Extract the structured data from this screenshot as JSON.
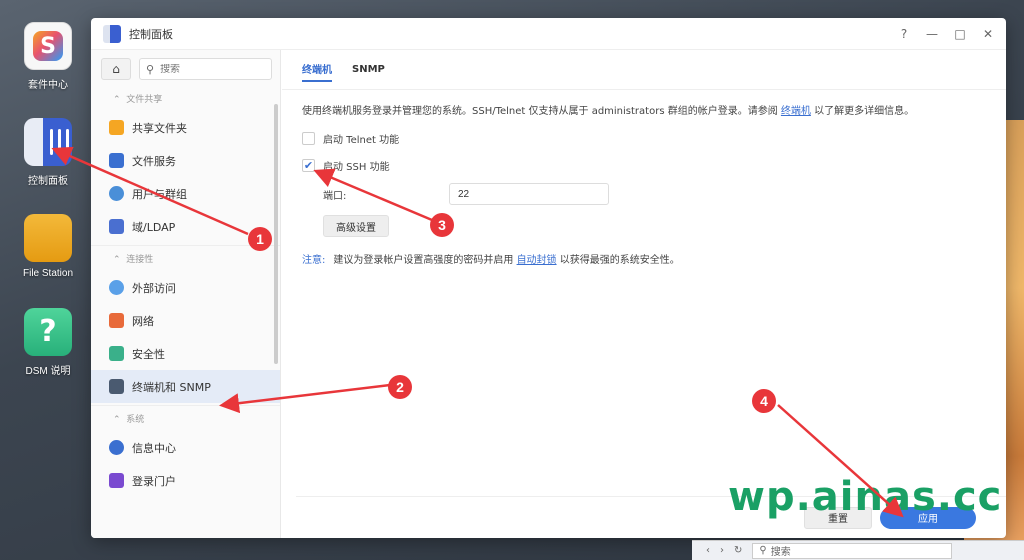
{
  "desktop": {
    "icons": [
      {
        "label": "套件中心",
        "glyph": "S"
      },
      {
        "label": "控制面板"
      },
      {
        "label": "File Station"
      },
      {
        "label": "DSM 说明",
        "glyph": "?"
      }
    ]
  },
  "window": {
    "title": "控制面板",
    "controls": {
      "help": "?",
      "minimize": "—",
      "maximize": "□",
      "close": "✕"
    }
  },
  "sidebar": {
    "home_glyph": "⌂",
    "search_placeholder": "搜索",
    "groups": [
      {
        "title": "文件共享",
        "items": [
          {
            "label": "共享文件夹",
            "color": "#f5a623"
          },
          {
            "label": "文件服务",
            "color": "#3a6fd0"
          },
          {
            "label": "用户与群组",
            "color": "#4a8fd8"
          },
          {
            "label": "域/LDAP",
            "color": "#4a6fd0"
          }
        ]
      },
      {
        "title": "连接性",
        "items": [
          {
            "label": "外部访问",
            "color": "#5aa0e8"
          },
          {
            "label": "网络",
            "color": "#e86a3a"
          },
          {
            "label": "安全性",
            "color": "#3ab08a"
          },
          {
            "label": "终端机和 SNMP",
            "color": "#4a5a70"
          }
        ]
      },
      {
        "title": "系统",
        "items": [
          {
            "label": "信息中心",
            "color": "#3a6fd0"
          },
          {
            "label": "登录门户",
            "color": "#7a4ad0"
          }
        ]
      }
    ],
    "active": "终端机和 SNMP"
  },
  "main": {
    "tabs": [
      {
        "label": "终端机"
      },
      {
        "label": "SNMP"
      }
    ],
    "active_tab": "终端机",
    "description_pre": "使用终端机服务登录并管理您的系统。SSH/Telnet 仅支持从属于 administrators 群组的帐户登录。请参阅 ",
    "description_link": "终端机",
    "description_post": " 以了解更多详细信息。",
    "telnet_label": "启动 Telnet 功能",
    "telnet_checked": false,
    "ssh_label": "启动 SSH 功能",
    "ssh_checked": true,
    "check_glyph": "✔",
    "port_label": "端口:",
    "port_value": "22",
    "advanced_button": "高级设置",
    "note_label": "注意:",
    "note_pre": "建议为登录帐户设置高强度的密码并启用 ",
    "note_link": "自动封锁",
    "note_post": " 以获得最强的系统安全性。",
    "reset_button": "重置",
    "apply_button": "应用"
  },
  "watermark": "wp.ainas.cc",
  "background_window": {
    "nav_back": "‹",
    "nav_forward": "›",
    "refresh": "↻",
    "search_placeholder": "搜索"
  },
  "annotations": [
    "1",
    "2",
    "3",
    "4"
  ],
  "colors": {
    "accent": "#3a6fd0",
    "apply": "#3a78e0",
    "annotation": "#e8363a",
    "watermark": "#1aa065"
  }
}
